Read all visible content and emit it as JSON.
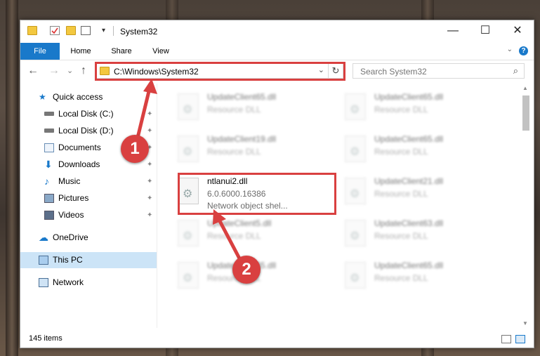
{
  "window": {
    "title": "System32",
    "minimize_glyph": "—",
    "maximize_glyph": "☐",
    "close_glyph": "✕"
  },
  "ribbon": {
    "tabs": [
      "File",
      "Home",
      "Share",
      "View"
    ],
    "help_glyph": "?",
    "expand_glyph": "⌄"
  },
  "navbar": {
    "back_glyph": "←",
    "forward_glyph": "→",
    "recent_glyph": "⌄",
    "up_glyph": "↑",
    "address": "C:\\Windows\\System32",
    "address_dropdown_glyph": "⌄",
    "refresh_glyph": "↻",
    "search_placeholder": "Search System32",
    "search_glyph": "⌕"
  },
  "sidebar": {
    "items": [
      {
        "label": "Quick access",
        "icon": "star-icon",
        "pinned": false
      },
      {
        "label": "Local Disk (C:)",
        "icon": "drive-icon",
        "pinned": true
      },
      {
        "label": "Local Disk (D:)",
        "icon": "drive-icon",
        "pinned": true
      },
      {
        "label": "Documents",
        "icon": "documents-icon",
        "pinned": true
      },
      {
        "label": "Downloads",
        "icon": "download-icon",
        "pinned": true
      },
      {
        "label": "Music",
        "icon": "music-icon",
        "pinned": true
      },
      {
        "label": "Pictures",
        "icon": "pictures-icon",
        "pinned": true
      },
      {
        "label": "Videos",
        "icon": "videos-icon",
        "pinned": true
      },
      {
        "label": "OneDrive",
        "icon": "cloud-icon",
        "pinned": false
      },
      {
        "label": "This PC",
        "icon": "pc-icon",
        "pinned": false,
        "selected": true
      },
      {
        "label": "Network",
        "icon": "network-icon",
        "pinned": false
      }
    ],
    "pin_glyph": "📌"
  },
  "files": [
    {
      "name": "UpdateClient65.dll",
      "line2": "Resource DLL",
      "line3": ""
    },
    {
      "name": "UpdateClient65.dll",
      "line2": "Resource DLL",
      "line3": ""
    },
    {
      "name": "UpdateClient19.dll",
      "line2": "Resource DLL",
      "line3": ""
    },
    {
      "name": "UpdateClient65.dll",
      "line2": "Resource DLL",
      "line3": ""
    },
    {
      "name": "ntlanui2.dll",
      "line2": "6.0.6000.16386",
      "line3": "Network object shel...",
      "highlighted": true
    },
    {
      "name": "UpdateClient21.dll",
      "line2": "Resource DLL",
      "line3": ""
    },
    {
      "name": "UpdateClient5.dll",
      "line2": "Resource DLL",
      "line3": ""
    },
    {
      "name": "UpdateClient63.dll",
      "line2": "Resource DLL",
      "line3": ""
    },
    {
      "name": "UpdateClient65.dll",
      "line2": "Resource DLL",
      "line3": ""
    },
    {
      "name": "UpdateClient65.dll",
      "line2": "Resource DLL",
      "line3": ""
    }
  ],
  "status": {
    "item_count": "145 items"
  },
  "callouts": [
    "1",
    "2"
  ],
  "colors": {
    "accent": "#1979ca",
    "highlight": "#d94040",
    "selected": "#cce4f7"
  }
}
